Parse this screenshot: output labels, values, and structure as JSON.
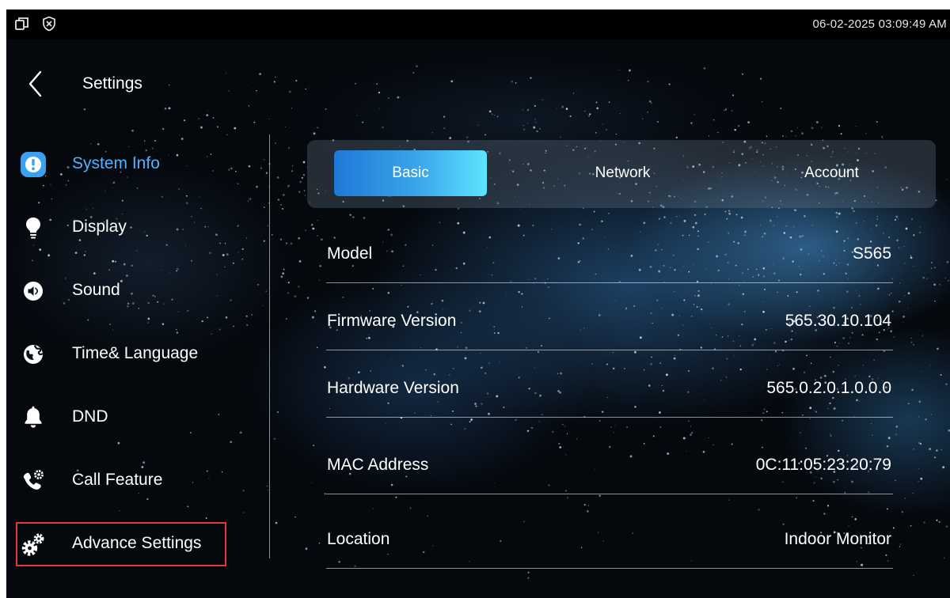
{
  "status_bar": {
    "datetime": "06-02-2025 03:09:49 AM",
    "icons": [
      "window-restore-icon",
      "shield-x-icon"
    ]
  },
  "header": {
    "title": "Settings",
    "back_icon": "chevron-left-icon"
  },
  "sidebar": {
    "items": [
      {
        "label": "System Info",
        "icon": "info-circle-icon",
        "state": "active"
      },
      {
        "label": "Display",
        "icon": "lightbulb-icon"
      },
      {
        "label": "Sound",
        "icon": "speaker-icon"
      },
      {
        "label": "Time& Language",
        "icon": "globe-icon"
      },
      {
        "label": "DND",
        "icon": "bell-icon"
      },
      {
        "label": "Call Feature",
        "icon": "phone-gear-icon"
      },
      {
        "label": "Advance Settings",
        "icon": "gears-icon",
        "state": "highlighted"
      }
    ]
  },
  "tabs": [
    {
      "label": "Basic",
      "state": "active"
    },
    {
      "label": "Network"
    },
    {
      "label": "Account"
    }
  ],
  "info": [
    {
      "label": "Model",
      "value": "S565"
    },
    {
      "label": "Firmware Version",
      "value": "565.30.10.104"
    },
    {
      "label": "Hardware Version",
      "value": "565.0.2.0.1.0.0.0"
    },
    {
      "label": "MAC Address",
      "value": "0C:11:05:23:20:79"
    },
    {
      "label": "Location",
      "value": "Indoor Monitor"
    }
  ],
  "colors": {
    "accent_text": "#4fb3ff",
    "tab_gradient_start": "#1f78d6",
    "tab_gradient_end": "#5ee4ff",
    "highlight_outline": "#e53935",
    "icon_blue": "#3aa0f0",
    "background": "#05080d"
  }
}
